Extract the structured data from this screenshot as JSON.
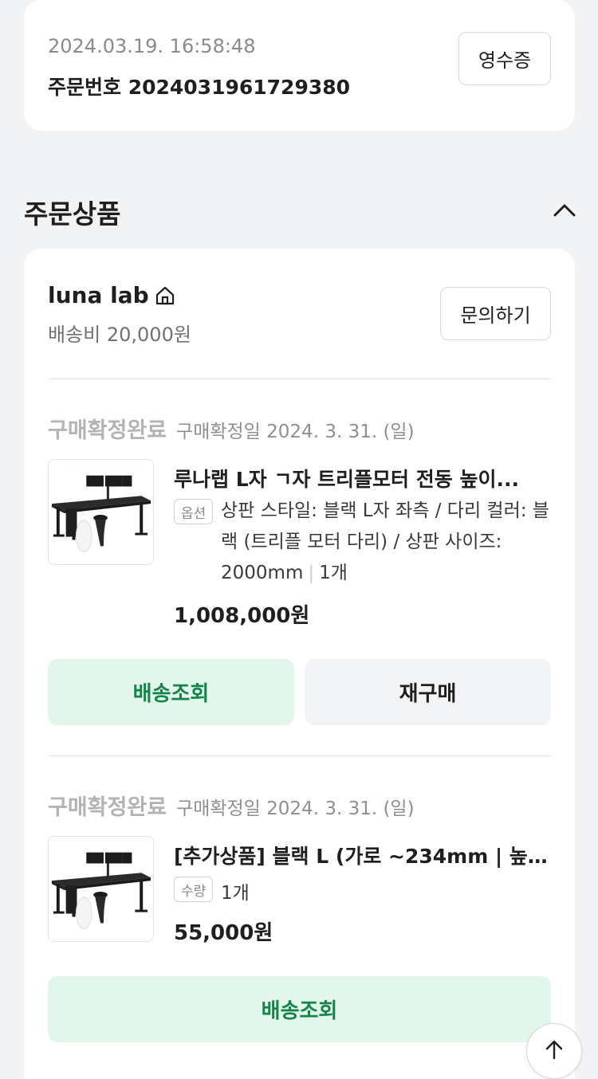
{
  "order": {
    "datetime": "2024.03.19. 16:58:48",
    "number": "주문번호 2024031961729380",
    "receipt_label": "영수증"
  },
  "section": {
    "title": "주문상품"
  },
  "seller": {
    "name": "luna lab",
    "shipping_fee": "배송비 20,000원",
    "inquiry_label": "문의하기"
  },
  "items": [
    {
      "status": "구매확정완료",
      "confirm_date": "구매확정일 2024. 3. 31. (일)",
      "title": "루나랩 L자 ㄱ자 트리플모터 전동 높이...",
      "tag": "옵션",
      "option": "상판 스타일: 블랙 L자 좌측 / 다리 컬러: 블랙 (트리플 모터 다리) / 상판 사이즈: 2000mm",
      "quantity": "1개",
      "price": "1,008,000원",
      "btn_track": "배송조회",
      "btn_rebuy": "재구매"
    },
    {
      "status": "구매확정완료",
      "confirm_date": "구매확정일 2024. 3. 31. (일)",
      "title": "[추가상품] 블랙 L (가로 ~234mm | 높...",
      "tag": "수량",
      "quantity": "1개",
      "price": "55,000원",
      "btn_track": "배송조회"
    }
  ],
  "colors": {
    "accent_green": "#14854a",
    "green_bg": "#e3f6ec",
    "page_bg": "#f2f3f5"
  }
}
